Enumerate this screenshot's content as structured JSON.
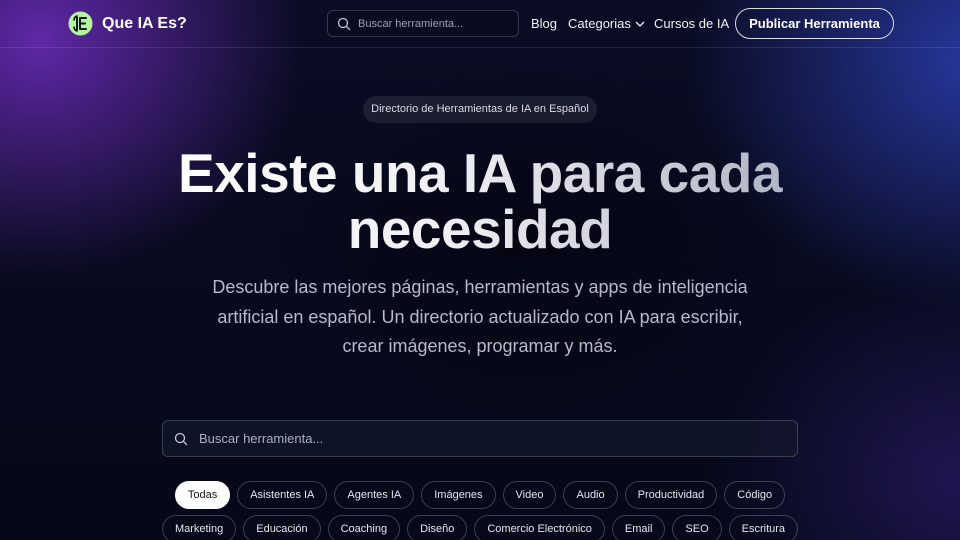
{
  "header": {
    "logo_text": "Que IA Es?",
    "search_placeholder": "Buscar herramienta...",
    "nav": {
      "blog": "Blog",
      "categorias": "Categorias",
      "cursos": "Cursos de IA"
    },
    "publish_button": "Publicar Herramienta"
  },
  "hero": {
    "badge": "Directorio de Herramientas de IA en Español",
    "title_line1": "Existe una IA para cada",
    "title_line2": "necesidad",
    "description": "Descubre las mejores páginas, herramientas y apps de inteligencia artificial en español. Un directorio actualizado con IA para escribir, crear imágenes, programar y más."
  },
  "search": {
    "placeholder": "Buscar herramienta..."
  },
  "categories": {
    "row1": [
      "Todas",
      "Asistentes IA",
      "Agentes IA",
      "Imágenes",
      "Video",
      "Audio",
      "Productividad",
      "Código"
    ],
    "row2": [
      "Marketing",
      "Educación",
      "Coaching",
      "Diseño",
      "Comercio Electrónico",
      "Email",
      "SEO",
      "Escritura"
    ],
    "active": "Todas"
  },
  "colors": {
    "background": "#050818",
    "accent_purple": "#6e2dbe",
    "accent_blue": "#3246c8",
    "logo_green": "#b6f3a0"
  }
}
